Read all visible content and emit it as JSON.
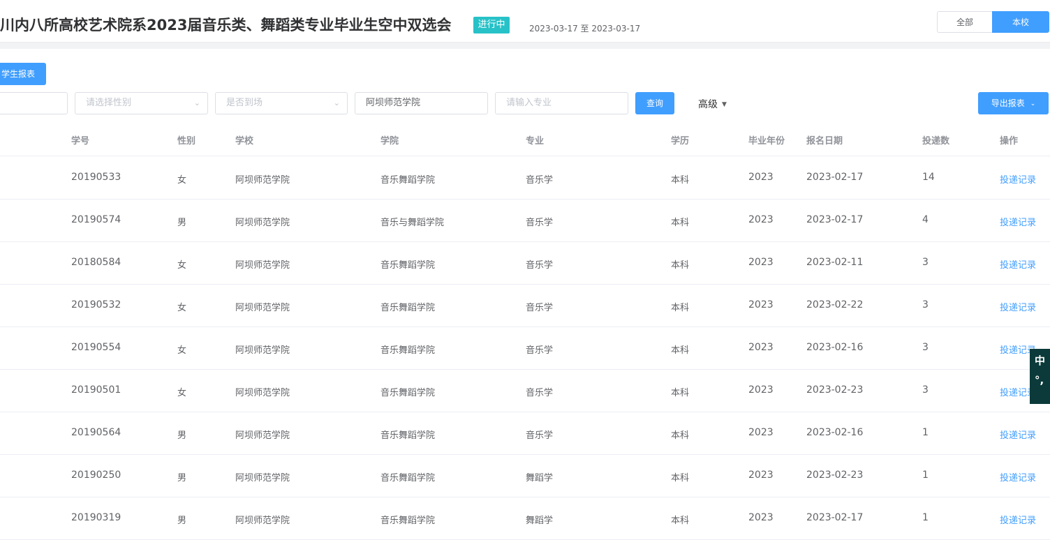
{
  "header": {
    "title": "川内八所高校艺术院系2023届音乐类、舞蹈类专业毕业生空中双选会",
    "status_badge": "进行中",
    "date_range": "2023-03-17 至 2023-03-17",
    "scope_toggle": {
      "all_label": "全部",
      "mine_label": "本校",
      "selected": "本校"
    }
  },
  "toolbar": {
    "student_report_label": "学生报表",
    "gender_placeholder": "请选择性别",
    "attendance_placeholder": "是否到场",
    "school_value": "阿坝师范学院",
    "major_placeholder": "请输入专业",
    "query_label": "查询",
    "advanced_label": "高级",
    "export_label": "导出报表"
  },
  "table": {
    "columns": [
      "学号",
      "性别",
      "学校",
      "学院",
      "专业",
      "学历",
      "毕业年份",
      "报名日期",
      "投递数",
      "操作"
    ],
    "rows": [
      {
        "id": "20190533",
        "sex": "女",
        "school": "阿坝师范学院",
        "college": "音乐舞蹈学院",
        "major": "音乐学",
        "edu": "本科",
        "year": "2023",
        "date": "2023-02-17",
        "count": "14",
        "action": "投递记录"
      },
      {
        "id": "20190574",
        "sex": "男",
        "school": "阿坝师范学院",
        "college": "音乐与舞蹈学院",
        "major": "音乐学",
        "edu": "本科",
        "year": "2023",
        "date": "2023-02-17",
        "count": "4",
        "action": "投递记录"
      },
      {
        "id": "20180584",
        "sex": "女",
        "school": "阿坝师范学院",
        "college": "音乐舞蹈学院",
        "major": "音乐学",
        "edu": "本科",
        "year": "2023",
        "date": "2023-02-11",
        "count": "3",
        "action": "投递记录"
      },
      {
        "id": "20190532",
        "sex": "女",
        "school": "阿坝师范学院",
        "college": "音乐舞蹈学院",
        "major": "音乐学",
        "edu": "本科",
        "year": "2023",
        "date": "2023-02-22",
        "count": "3",
        "action": "投递记录"
      },
      {
        "id": "20190554",
        "sex": "女",
        "school": "阿坝师范学院",
        "college": "音乐舞蹈学院",
        "major": "音乐学",
        "edu": "本科",
        "year": "2023",
        "date": "2023-02-16",
        "count": "3",
        "action": "投递记录"
      },
      {
        "id": "20190501",
        "sex": "女",
        "school": "阿坝师范学院",
        "college": "音乐舞蹈学院",
        "major": "音乐学",
        "edu": "本科",
        "year": "2023",
        "date": "2023-02-23",
        "count": "3",
        "action": "投递记录"
      },
      {
        "id": "20190564",
        "sex": "男",
        "school": "阿坝师范学院",
        "college": "音乐舞蹈学院",
        "major": "音乐学",
        "edu": "本科",
        "year": "2023",
        "date": "2023-02-16",
        "count": "1",
        "action": "投递记录"
      },
      {
        "id": "20190250",
        "sex": "男",
        "school": "阿坝师范学院",
        "college": "音乐舞蹈学院",
        "major": "舞蹈学",
        "edu": "本科",
        "year": "2023",
        "date": "2023-02-23",
        "count": "1",
        "action": "投递记录"
      },
      {
        "id": "20190319",
        "sex": "男",
        "school": "阿坝师范学院",
        "college": "音乐舞蹈学院",
        "major": "舞蹈学",
        "edu": "本科",
        "year": "2023",
        "date": "2023-02-17",
        "count": "1",
        "action": "投递记录"
      }
    ]
  },
  "ime_indicator": {
    "mode": "中",
    "punct": "°,"
  },
  "colors": {
    "primary": "#409eff",
    "status_badge": "#27c2c8",
    "band": "#f2f3f5"
  },
  "icons": {
    "select_chevron": "chevron-down-icon",
    "dropdown_caret": "caret-down-icon"
  }
}
